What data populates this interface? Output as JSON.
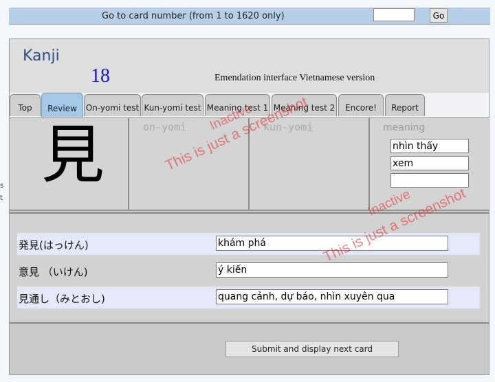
{
  "topbar": {
    "goto_label": "Go to card number (from 1 to 1620 only)",
    "card_input_value": "",
    "go_label": "Go"
  },
  "header": {
    "app_title": "Kanji",
    "card_number": "18",
    "interface_note": "Emendation interface  Vietnamese version"
  },
  "tabs": [
    {
      "label": "Top"
    },
    {
      "label": "Review"
    },
    {
      "label": "On-yomi test"
    },
    {
      "label": "Kun-yomi test"
    },
    {
      "label": "Meaning test 1"
    },
    {
      "label": "Meaning test 2"
    },
    {
      "label": "Encore!"
    },
    {
      "label": "Report"
    }
  ],
  "active_tab": "Review",
  "kanji": {
    "character": "見",
    "onyomi_label": "on-yomi",
    "kunyomi_label": "kun-yomi",
    "meaning_label": "meaning",
    "meanings": [
      "nhìn thấy",
      "xem",
      ""
    ]
  },
  "words": [
    {
      "label": "発見(はっけん)",
      "value": "khám phá"
    },
    {
      "label": "意見 （いけん)",
      "value": "ý kiến"
    },
    {
      "label": "見通し（みとおし)",
      "value": "quang cảnh, dự báo, nhìn xuyên qua"
    }
  ],
  "submit_label": "Submit and display next card",
  "watermark": {
    "line1": "Inactive",
    "line2": "This is just a screenshot"
  },
  "stray_edge_chars": [
    "s",
    "t"
  ],
  "colors": {
    "topbar": "#b7cfe6",
    "active_tab": "#a5c7e8",
    "title": "#2e4f86",
    "card_number": "#1414d2",
    "watermark": "#e02828"
  }
}
